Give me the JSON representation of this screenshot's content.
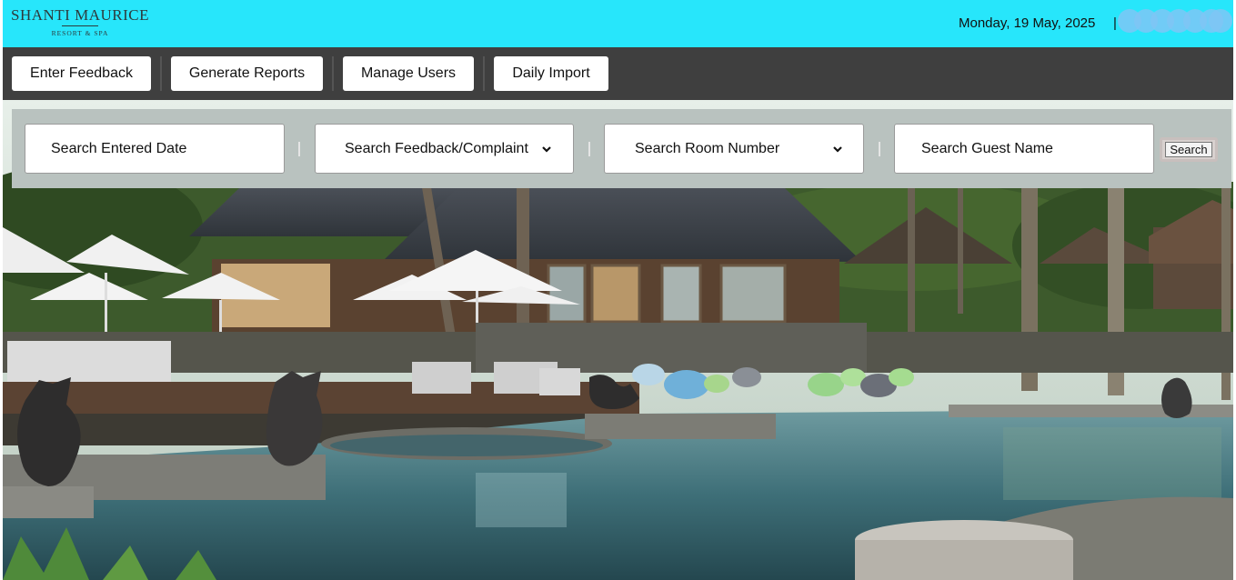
{
  "header": {
    "logo_main": "SHANTI MAURICE",
    "logo_sub": "RESORT & SPA",
    "date": "Monday, 19 May, 2025",
    "user_separator": "|"
  },
  "nav": {
    "items": [
      {
        "label": "Enter Feedback"
      },
      {
        "label": "Generate Reports"
      },
      {
        "label": "Manage Users"
      },
      {
        "label": "Daily Import"
      }
    ]
  },
  "search": {
    "entered_date_placeholder": "Search Entered Date",
    "feedback_label": "Search Feedback/Complaint",
    "room_label": "Search Room Number",
    "guest_placeholder": "Search Guest Name",
    "button_label": "Search"
  },
  "colors": {
    "header_bg": "#27e6fb",
    "nav_bg": "#3f3f3f",
    "search_panel_bg": "#b9c2bf"
  },
  "icons": {
    "dropdown": "chevron-down-icon"
  }
}
